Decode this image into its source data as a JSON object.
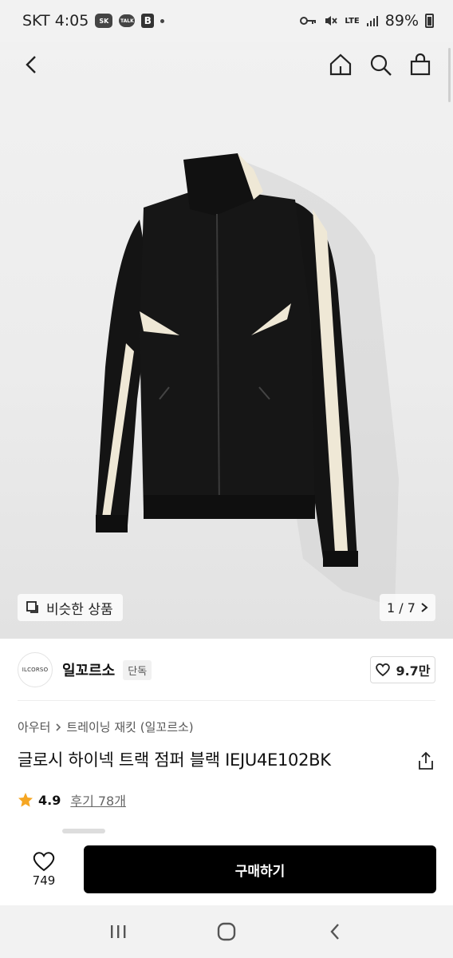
{
  "status_bar": {
    "carrier_time": "SKT 4:05",
    "badge_sk": "SK",
    "badge_talk": "TALK",
    "badge_b": "B",
    "lte": "LTE",
    "battery": "89%"
  },
  "nav": {
    "back_icon": "back-arrow-icon",
    "home_icon": "home-icon",
    "search_icon": "search-icon",
    "cart_icon": "shopping-bag-icon"
  },
  "gallery": {
    "similar_label": "비슷한 상품",
    "pager": "1 / 7"
  },
  "brand": {
    "logo_text": "ILCORSO",
    "name": "일꼬르소",
    "tag": "단독",
    "likes": "9.7만"
  },
  "breadcrumb": {
    "category": "아우터",
    "subcategory": "트레이닝 재킷 (일꼬르소)"
  },
  "product": {
    "title": "글로시 하이넥 트랙 점퍼 블랙 IEJU4E102BK",
    "rating": "4.9",
    "reviews": "후기 78개"
  },
  "purchase": {
    "wish_count": "749",
    "buy_label": "구매하기"
  },
  "colors": {
    "accent_star": "#f5a623",
    "buy_button": "#000000",
    "jacket_black": "#141414",
    "stripe_cream": "#efe8d6"
  }
}
